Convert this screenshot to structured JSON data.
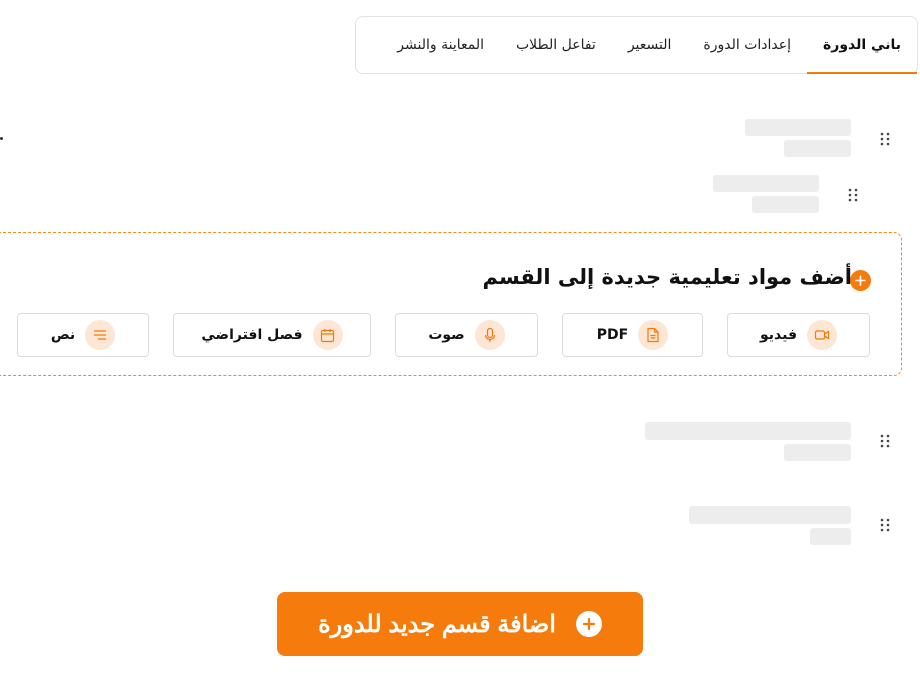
{
  "tabs": [
    {
      "label": "باني الدورة",
      "active": true
    },
    {
      "label": "إعدادات الدورة"
    },
    {
      "label": "التسعير"
    },
    {
      "label": "تفاعل الطلاب"
    },
    {
      "label": "المعاينة والنشر"
    }
  ],
  "add_material": {
    "title": "أضف مواد تعليمية جديدة إلى القسم",
    "types": [
      {
        "label": "فيديو",
        "icon": "video-icon"
      },
      {
        "label": "PDF",
        "icon": "document-icon"
      },
      {
        "label": "صوت",
        "icon": "microphone-icon"
      },
      {
        "label": "فصل افتراضي",
        "icon": "calendar-icon"
      },
      {
        "label": "نص",
        "icon": "text-lines-icon"
      }
    ]
  },
  "add_section_button": "اضافة قسم جديد للدورة",
  "colors": {
    "accent": "#f57c0c",
    "icon_bg": "#fde6d4",
    "skeleton": "#ededed",
    "border_dashed": "#f08a1d"
  }
}
